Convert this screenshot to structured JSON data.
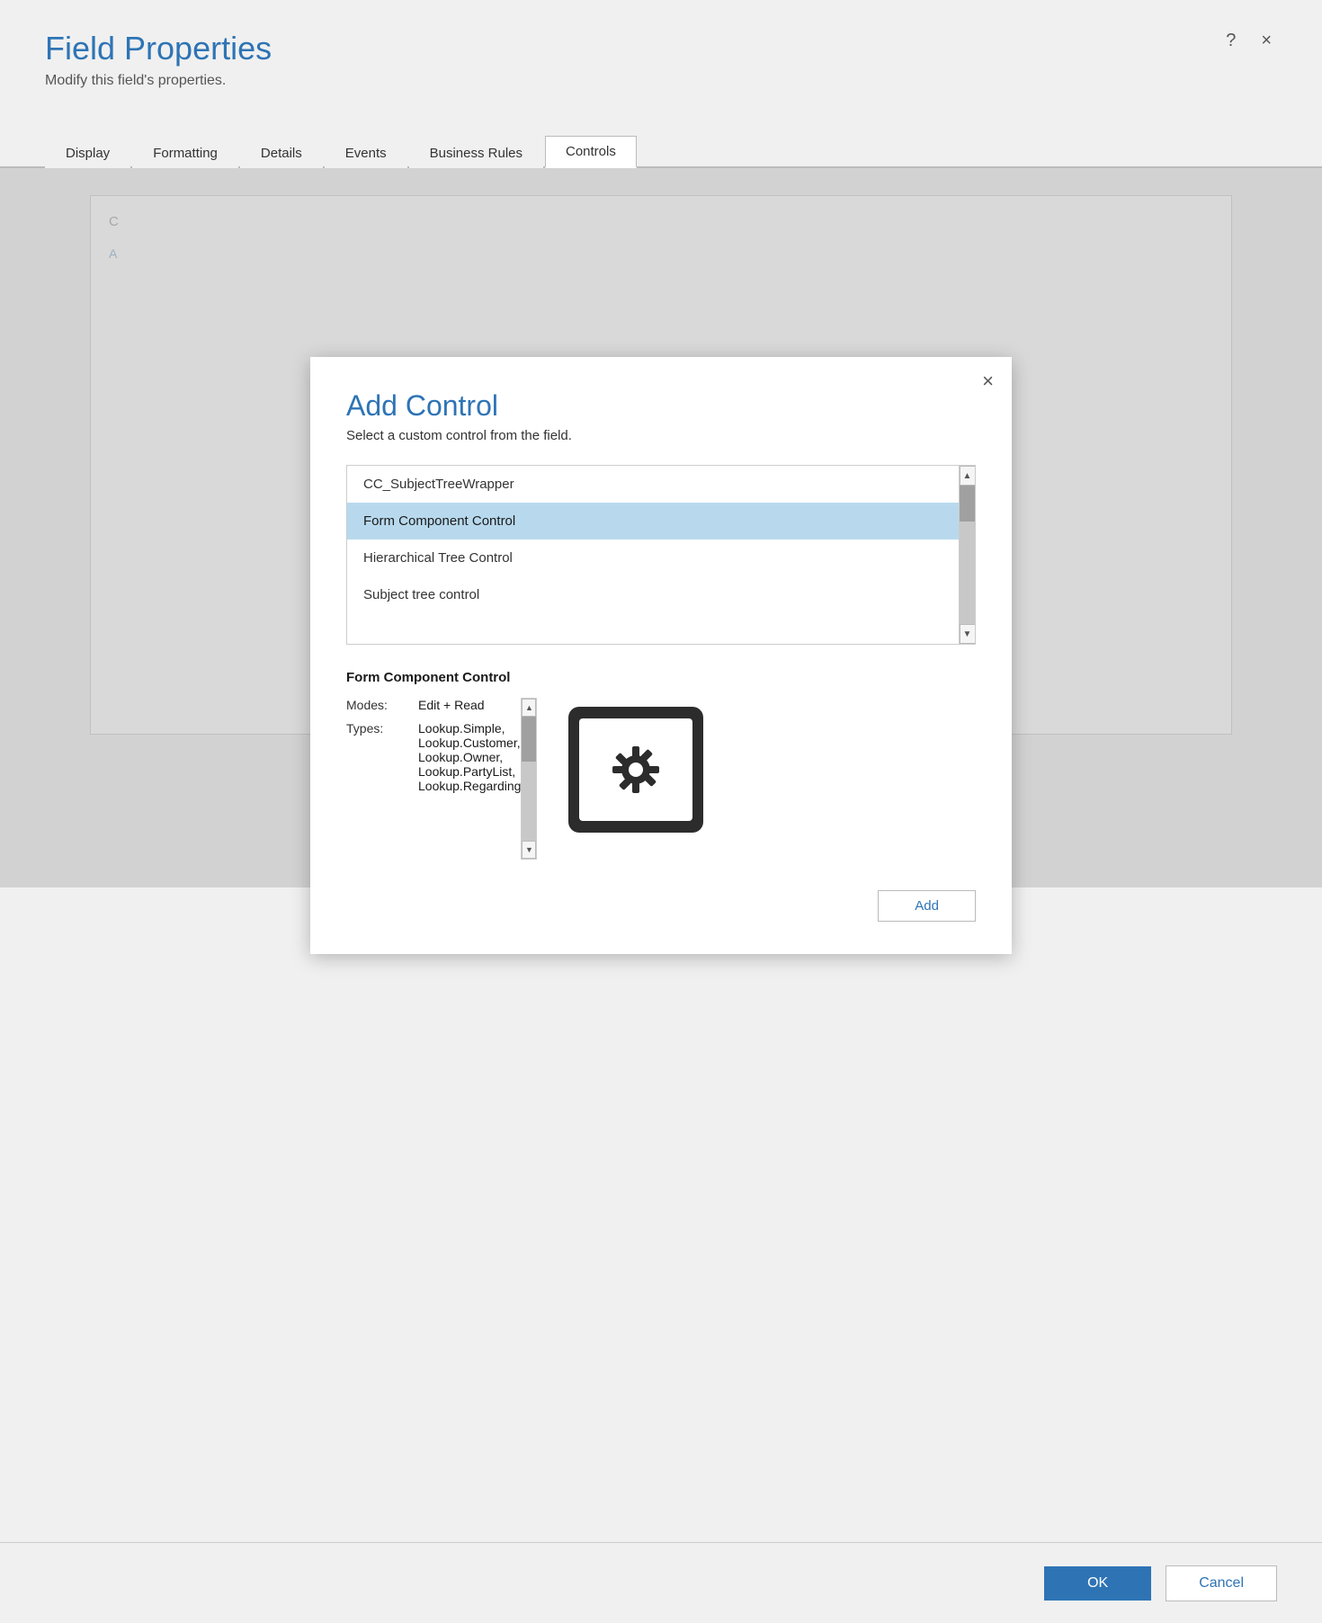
{
  "window": {
    "title": "Field Properties",
    "subtitle": "Modify this field's properties.",
    "help_btn": "?",
    "close_btn": "×"
  },
  "tabs": [
    {
      "id": "display",
      "label": "Display",
      "active": false
    },
    {
      "id": "formatting",
      "label": "Formatting",
      "active": false
    },
    {
      "id": "details",
      "label": "Details",
      "active": false
    },
    {
      "id": "events",
      "label": "Events",
      "active": false
    },
    {
      "id": "business-rules",
      "label": "Business Rules",
      "active": false
    },
    {
      "id": "controls",
      "label": "Controls",
      "active": true
    }
  ],
  "modal": {
    "title": "Add Control",
    "subtitle": "Select a custom control from the field.",
    "close_btn": "×",
    "list_items": [
      {
        "id": "cc-subject-tree-wrapper",
        "label": "CC_SubjectTreeWrapper",
        "selected": false
      },
      {
        "id": "form-component-control",
        "label": "Form Component Control",
        "selected": true
      },
      {
        "id": "hierarchical-tree-control",
        "label": "Hierarchical Tree Control",
        "selected": false
      },
      {
        "id": "subject-tree-control",
        "label": "Subject tree control",
        "selected": false
      }
    ],
    "details": {
      "title": "Form Component Control",
      "modes_label": "Modes:",
      "modes_value": "Edit + Read",
      "types_label": "Types:",
      "types_value": "Lookup.Simple,\nLookup.Customer,\nLookup.Owner,\nLookup.PartyList,\nLookup.Regarding"
    },
    "add_button": "Add"
  },
  "footer": {
    "ok_label": "OK",
    "cancel_label": "Cancel"
  },
  "background_label": "C",
  "bg_link": "A"
}
